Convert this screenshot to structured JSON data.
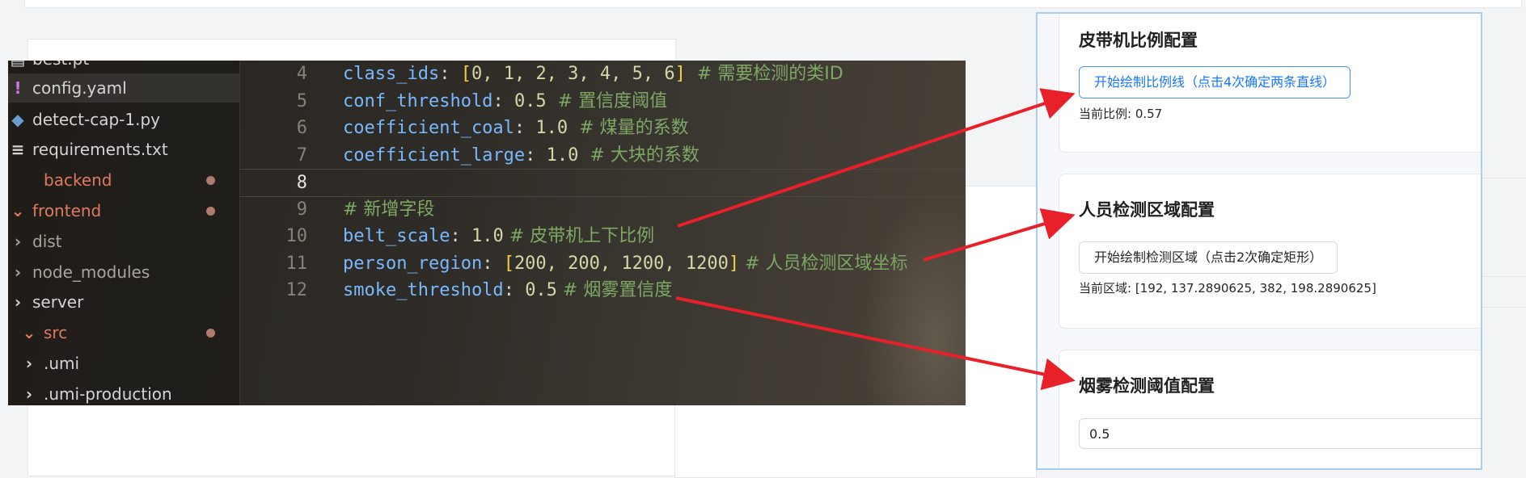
{
  "explorer": {
    "items": [
      {
        "label": "best.pt",
        "icon": "file-icon",
        "icon_glyph": "▤",
        "state": "normal"
      },
      {
        "label": "config.yaml",
        "icon": "yaml-icon",
        "icon_glyph": "!",
        "state": "active"
      },
      {
        "label": "detect-cap-1.py",
        "icon": "python-icon",
        "icon_glyph": "◆",
        "state": "normal"
      },
      {
        "label": "requirements.txt",
        "icon": "text-file-icon",
        "icon_glyph": "≡",
        "state": "normal"
      },
      {
        "label": "backend",
        "icon": "folder-icon",
        "icon_glyph": "",
        "state": "modified"
      },
      {
        "label": "frontend",
        "icon": "folder-open-icon",
        "icon_glyph": "⌄",
        "state": "modified"
      },
      {
        "label": "dist",
        "icon": "chevron-right-icon",
        "icon_glyph": "›",
        "state": "dim"
      },
      {
        "label": "node_modules",
        "icon": "chevron-right-icon",
        "icon_glyph": "›",
        "state": "dim"
      },
      {
        "label": "server",
        "icon": "chevron-right-icon",
        "icon_glyph": "›",
        "state": "normal"
      },
      {
        "label": "src",
        "icon": "chevron-down-icon",
        "icon_glyph": "⌄",
        "state": "modified"
      },
      {
        "label": ".umi",
        "icon": "chevron-right-icon",
        "icon_glyph": "›",
        "state": "normal"
      },
      {
        "label": ".umi-production",
        "icon": "chevron-right-icon",
        "icon_glyph": "›",
        "state": "normal"
      }
    ]
  },
  "code": {
    "current_line": "8",
    "lines": [
      {
        "num": "4",
        "key": "class_ids",
        "sep": ": ",
        "open": "[",
        "val": "0, 1, 2, 3, 4, 5, 6",
        "close": "]",
        "comment": "  # 需要检测的类ID"
      },
      {
        "num": "5",
        "key": "conf_threshold",
        "sep": ": ",
        "open": "",
        "val": "0.5",
        "close": "",
        "comment": "  # 置信度阈值"
      },
      {
        "num": "6",
        "key": "coefficient_coal",
        "sep": ": ",
        "open": "",
        "val": "1.0",
        "close": "",
        "comment": "  # 煤量的系数"
      },
      {
        "num": "7",
        "key": "coefficient_large",
        "sep": ": ",
        "open": "",
        "val": "1.0",
        "close": "",
        "comment": "  # 大块的系数"
      },
      {
        "num": "8",
        "key": "",
        "sep": "",
        "open": "",
        "val": "",
        "close": "",
        "comment": ""
      },
      {
        "num": "9",
        "key": "",
        "sep": "",
        "open": "",
        "val": "",
        "close": "",
        "comment": "# 新增字段"
      },
      {
        "num": "10",
        "key": "belt_scale",
        "sep": ": ",
        "open": "",
        "val": "1.0",
        "close": "",
        "comment": " # 皮带机上下比例"
      },
      {
        "num": "11",
        "key": "person_region",
        "sep": ": ",
        "open": "[",
        "val": "200, 200, 1200, 1200",
        "close": "]",
        "comment": " # 人员检测区域坐标"
      },
      {
        "num": "12",
        "key": "smoke_threshold",
        "sep": ": ",
        "open": "",
        "val": "0.5",
        "close": "",
        "comment": " # 烟雾置信度"
      }
    ]
  },
  "panel": {
    "belt": {
      "title": "皮带机比例配置",
      "button": "开始绘制比例线（点击4次确定两条直线）",
      "info": "当前比例: 0.57"
    },
    "person": {
      "title": "人员检测区域配置",
      "button": "开始绘制检测区域（点击2次确定矩形）",
      "info": "当前区域: [192, 137.2890625, 382, 198.2890625]"
    },
    "smoke": {
      "title": "烟雾检测阈值配置",
      "input_value": "0.5"
    }
  },
  "colors": {
    "arrow": "#e8202a",
    "accent": "#1677ff",
    "panel_border": "#a9cdf4"
  }
}
